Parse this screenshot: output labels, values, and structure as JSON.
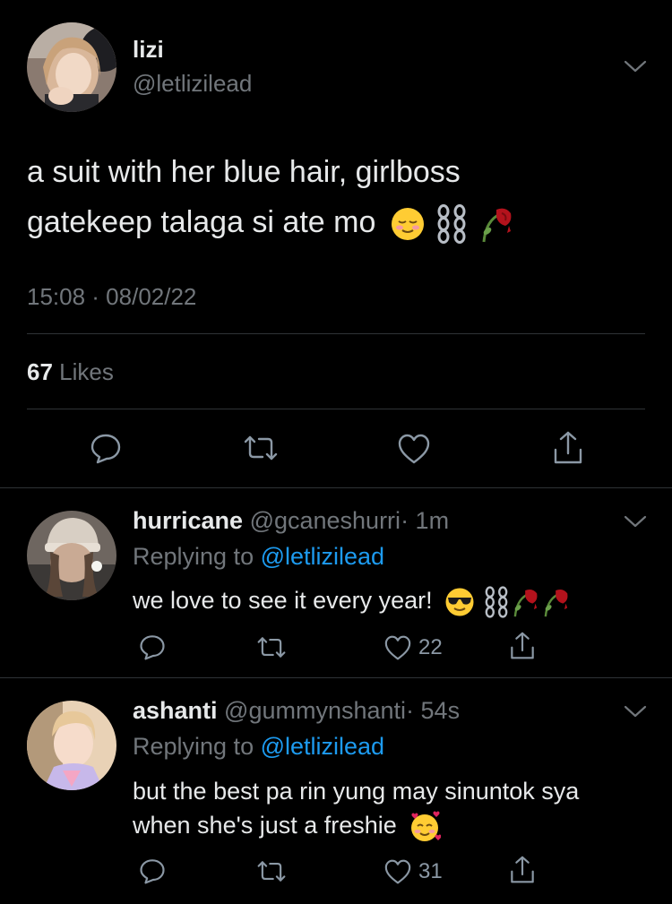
{
  "main_tweet": {
    "display_name": "lizi",
    "handle": "@letlizilead",
    "text_line1": "a suit with her blue hair, girlboss",
    "text_line2": "gatekeep talaga si ate mo",
    "emojis": [
      "relieved-face",
      "chains",
      "wilted-flower"
    ],
    "timestamp": "15:08 · 08/02/22",
    "likes_count": "67",
    "likes_label": "Likes"
  },
  "replies": [
    {
      "display_name": "hurricane",
      "handle": "@gcaneshurri",
      "time": "· 1m",
      "replying_prefix": "Replying to",
      "replying_handle": "@letlizilead",
      "text": "we love to see it every year!",
      "emojis": [
        "sunglasses-face",
        "chains",
        "wilted-flower",
        "wilted-flower"
      ],
      "likes": "22"
    },
    {
      "display_name": "ashanti",
      "handle": "@gummynshanti",
      "time": "· 54s",
      "replying_prefix": "Replying to",
      "replying_handle": "@letlizilead",
      "text_line1": "but the best pa rin yung may sinuntok sya",
      "text_line2": "when she's just a freshie",
      "emojis": [
        "smiling-face-with-hearts"
      ],
      "likes": "31"
    }
  ],
  "colors": {
    "background": "#000000",
    "text": "#e7e9ea",
    "muted": "#71767b",
    "link": "#1d9bf0",
    "divider": "#2f3336"
  }
}
